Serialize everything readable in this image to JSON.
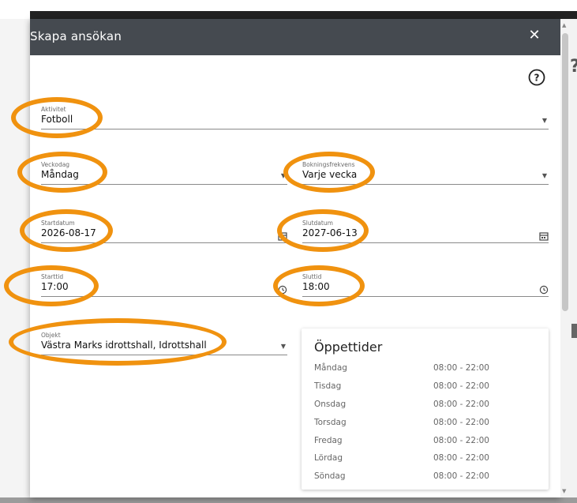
{
  "dialog": {
    "title": "Skapa ansökan",
    "close_icon": "close-icon",
    "help_icon": "help-circle-icon"
  },
  "form": {
    "aktivitet": {
      "label": "Aktivitet",
      "value": "Fotboll"
    },
    "veckodag": {
      "label": "Veckodag",
      "value": "Måndag"
    },
    "bokningsfrekvens": {
      "label": "Bokningsfrekvens",
      "value": "Varje vecka"
    },
    "startdatum": {
      "label": "Startdatum",
      "value": "2026-08-17"
    },
    "slutdatum": {
      "label": "Slutdatum",
      "value": "2027-06-13"
    },
    "starttid": {
      "label": "Starttid",
      "value": "17:00"
    },
    "sluttid": {
      "label": "Sluttid",
      "value": "18:00"
    },
    "objekt": {
      "label": "Objekt",
      "value": "Västra Marks idrottshall, Idrottshall"
    }
  },
  "opening_hours": {
    "title": "Öppettider",
    "rows": [
      {
        "day": "Måndag",
        "time": "08:00 - 22:00"
      },
      {
        "day": "Tisdag",
        "time": "08:00 - 22:00"
      },
      {
        "day": "Onsdag",
        "time": "08:00 - 22:00"
      },
      {
        "day": "Torsdag",
        "time": "08:00 - 22:00"
      },
      {
        "day": "Fredag",
        "time": "08:00 - 22:00"
      },
      {
        "day": "Lördag",
        "time": "08:00 - 22:00"
      },
      {
        "day": "Söndag",
        "time": "08:00 - 22:00"
      }
    ]
  },
  "colors": {
    "header_bg": "#454a50",
    "highlight": "#f0920f"
  }
}
